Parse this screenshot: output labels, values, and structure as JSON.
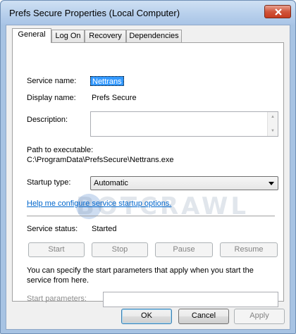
{
  "window": {
    "title": "Prefs Secure Properties (Local Computer)"
  },
  "tabs": [
    {
      "label": "General",
      "active": true
    },
    {
      "label": "Log On",
      "active": false
    },
    {
      "label": "Recovery",
      "active": false
    },
    {
      "label": "Dependencies",
      "active": false
    }
  ],
  "general": {
    "service_name_label": "Service name:",
    "service_name_value": "Nettrans",
    "display_name_label": "Display name:",
    "display_name_value": "Prefs Secure",
    "description_label": "Description:",
    "description_value": "",
    "path_label": "Path to executable:",
    "path_value": "C:\\ProgramData\\PrefsSecure\\Nettrans.exe",
    "startup_type_label": "Startup type:",
    "startup_type_value": "Automatic",
    "help_link": "Help me configure service startup options.",
    "service_status_label": "Service status:",
    "service_status_value": "Started",
    "start_button": "Start",
    "stop_button": "Stop",
    "pause_button": "Pause",
    "resume_button": "Resume",
    "params_note": "You can specify the start parameters that apply when you start the service from here.",
    "start_params_label": "Start parameters:",
    "start_params_value": ""
  },
  "footer": {
    "ok_button": "OK",
    "cancel_button": "Cancel",
    "apply_button": "Apply"
  },
  "watermark": {
    "text": "BOTCRAWL"
  },
  "icons": {
    "close": "close-icon",
    "dropdown": "chevron-down-icon",
    "scroll_up": "scroll-up-icon",
    "scroll_down": "scroll-down-icon"
  },
  "colors": {
    "selection": "#3399ff",
    "link": "#0066cc",
    "titlebar": "#b8d0ec",
    "close_button": "#c73c1f"
  }
}
